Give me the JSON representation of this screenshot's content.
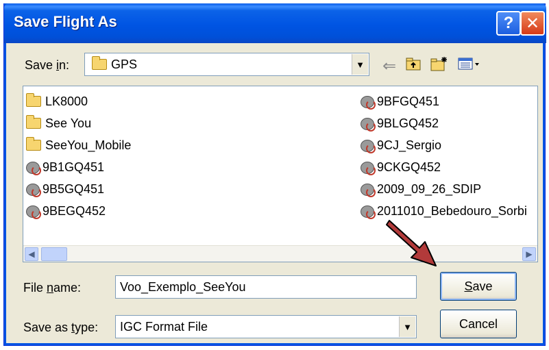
{
  "window": {
    "title": "Save Flight As",
    "help_label": "?",
    "close_label": "✕"
  },
  "save_in": {
    "label_prefix": "Save ",
    "label_underlined": "i",
    "label_suffix": "n:",
    "value": "GPS"
  },
  "toolbar": {
    "back_icon": "back-arrow-icon",
    "up_icon": "up-folder-icon",
    "new_folder_icon": "new-folder-icon",
    "views_icon": "views-menu-icon"
  },
  "files": {
    "left": [
      {
        "name": "LK8000",
        "type": "folder"
      },
      {
        "name": "See You",
        "type": "folder"
      },
      {
        "name": "SeeYou_Mobile",
        "type": "folder"
      },
      {
        "name": "9B1GQ451",
        "type": "file"
      },
      {
        "name": "9B5GQ451",
        "type": "file"
      },
      {
        "name": "9BEGQ452",
        "type": "file"
      }
    ],
    "right": [
      {
        "name": "9BFGQ451",
        "type": "file"
      },
      {
        "name": "9BLGQ452",
        "type": "file"
      },
      {
        "name": "9CJ_Sergio",
        "type": "file"
      },
      {
        "name": "9CKGQ452",
        "type": "file"
      },
      {
        "name": "2009_09_26_SDIP",
        "type": "file"
      },
      {
        "name": "2011010_Bebedouro_Sorbi",
        "type": "file"
      }
    ]
  },
  "file_name": {
    "label_prefix": "File ",
    "label_underlined": "n",
    "label_suffix": "ame:",
    "value": "Voo_Exemplo_SeeYou"
  },
  "save_type": {
    "label_prefix": "Save as ",
    "label_underlined": "t",
    "label_suffix": "ype:",
    "value": "IGC Format File"
  },
  "buttons": {
    "save_underlined": "S",
    "save_rest": "ave",
    "cancel": "Cancel"
  },
  "scrollbar": {
    "left_arrow": "◀",
    "right_arrow": "▶"
  },
  "colors": {
    "title_bar": "#0054e3",
    "dialog_bg": "#ece9d8",
    "arrow": "#b23a3a"
  }
}
